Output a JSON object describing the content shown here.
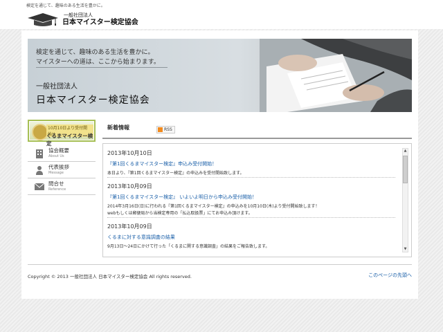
{
  "header": {
    "tagline": "検定を通じて、趣味のある生活を豊かに。",
    "logo_sub": "一般社団法人",
    "logo_main": "日本マイスター検定協会"
  },
  "hero": {
    "lead_line1": "検定を通じて、趣味のある生活を豊かに。",
    "lead_line2": "マイスターへの道は、ここから始まります。",
    "org_sub": "一般社団法人",
    "org_main": "日本マイスター検定協会"
  },
  "banner": {
    "line1": "10月10日より受付開始!!",
    "line2": "くるまマイスター検定"
  },
  "sidenav": {
    "items": [
      {
        "label": "協会概要",
        "sub": "About Us",
        "icon": "building-icon"
      },
      {
        "label": "代表挨拶",
        "sub": "Message",
        "icon": "person-icon"
      },
      {
        "label": "問合せ",
        "sub": "Reference",
        "icon": "mail-icon"
      }
    ]
  },
  "news": {
    "title": "新着情報",
    "rss_label": "RSS",
    "entries": [
      {
        "date": "2013年10月10日",
        "headline": "『第1回くるまマイスター検定』申込み受付開始！",
        "body": [
          "本日より、『第1回くるまマイスター検定』の申込みを受付開始致します。"
        ]
      },
      {
        "date": "2013年10月09日",
        "headline": "『第1回くるまマイスター検定』 いよいよ明日から申込み受付開始！",
        "body": [
          "2014年3月16日(日)に行われる『第1回くるまマイスター検定』の申込みを10月10日(木)より受付開始致します！",
          "webもしくは郵便局から当検定専用の「払込取扱票」にてお申込み頂けます。"
        ]
      },
      {
        "date": "2013年10月09日",
        "headline": "くるまに対する意識調査の結果",
        "body": [
          "9月13日～24日にかけて行った「くるまに関する意識調査」の結果をご報告致します。"
        ]
      }
    ]
  },
  "footer": {
    "copyright": "Copyright © 2013 一般社団法人 日本マイスター検定協会 All rights reserved.",
    "pagetop": "このページの先頭へ"
  }
}
